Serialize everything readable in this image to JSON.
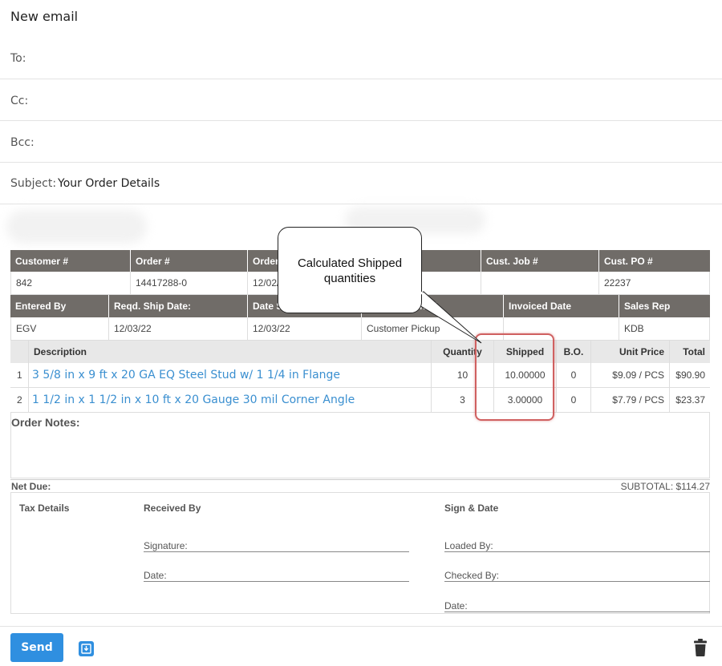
{
  "window": {
    "title": "New email"
  },
  "fields": {
    "to_label": "To:",
    "cc_label": "Cc:",
    "bcc_label": "Bcc:",
    "subject_label": "Subject:",
    "subject_value": "Your Order Details"
  },
  "order_header": {
    "row1": {
      "headers": [
        "Customer #",
        "Order #",
        "Order",
        "",
        "Cust. Job #",
        "Cust. PO #"
      ],
      "values": [
        "842",
        "14417288-0",
        "12/02/",
        "",
        "",
        "22237"
      ]
    },
    "row2": {
      "headers": [
        "Entered By",
        "Reqd. Ship Date:",
        "Date S",
        "thod",
        "Invoiced Date",
        "Sales Rep"
      ],
      "values": [
        "EGV",
        "12/03/22",
        "12/03/22",
        "Customer Pickup",
        "",
        "KDB"
      ]
    }
  },
  "items": {
    "columns": [
      "Description",
      "Quantity",
      "Shipped",
      "B.O.",
      "Unit Price",
      "Total"
    ],
    "rows": [
      {
        "num": "1",
        "description": "3 5/8 in x 9 ft x 20 GA EQ Steel Stud w/ 1 1/4 in Flange",
        "quantity": "10",
        "shipped": "10.00000",
        "bo": "0",
        "unit_price": "$9.09 / PCS",
        "total": "$90.90"
      },
      {
        "num": "2",
        "description": "1 1/2 in x 1 1/2 in x 10 ft x 20 Gauge 30 mil Corner Angle",
        "quantity": "3",
        "shipped": "3.00000",
        "bo": "0",
        "unit_price": "$7.79 / PCS",
        "total": "$23.37"
      }
    ]
  },
  "notes": {
    "label": "Order Notes:"
  },
  "totals": {
    "net_due_label": "Net Due:",
    "subtotal": "SUBTOTAL: $114.27"
  },
  "footer": {
    "tax_details": "Tax Details",
    "received_by": "Received By",
    "signature": "Signature:",
    "date": "Date:",
    "sign_date": "Sign & Date",
    "loaded_by": "Loaded By:",
    "checked_by": "Checked By:",
    "date2": "Date:"
  },
  "callout": {
    "text": "Calculated Shipped quantities"
  },
  "actions": {
    "send_label": "Send"
  },
  "colors": {
    "accent": "#2f8fe0",
    "header_bg": "#706c68",
    "link": "#3a8fd0",
    "highlight": "#d06060"
  },
  "icons": {
    "save": "save-draft-icon",
    "trash": "trash-icon"
  }
}
